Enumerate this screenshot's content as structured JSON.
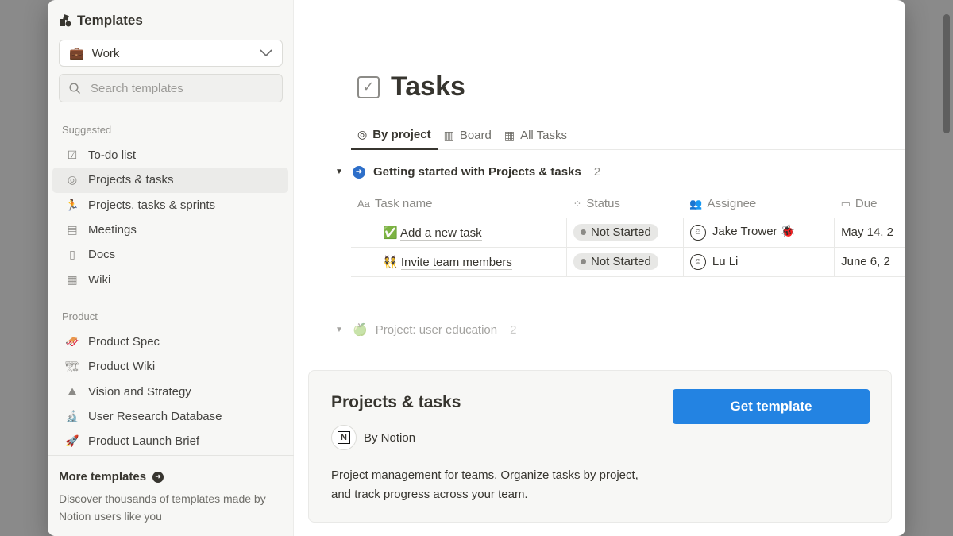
{
  "sidebar": {
    "title": "Templates",
    "category": "Work",
    "search_placeholder": "Search templates",
    "sections": [
      {
        "label": "Suggested",
        "items": [
          {
            "label": "To-do list",
            "icon": "checkbox-icon"
          },
          {
            "label": "Projects & tasks",
            "icon": "target-icon",
            "active": true
          },
          {
            "label": "Projects, tasks & sprints",
            "icon": "runner-icon"
          },
          {
            "label": "Meetings",
            "icon": "notes-icon"
          },
          {
            "label": "Docs",
            "icon": "document-icon"
          },
          {
            "label": "Wiki",
            "icon": "book-icon"
          }
        ]
      },
      {
        "label": "Product",
        "items": [
          {
            "label": "Product Spec",
            "icon": "sled-emoji"
          },
          {
            "label": "Product Wiki",
            "icon": "crane-emoji"
          },
          {
            "label": "Vision and Strategy",
            "icon": "mountain-emoji"
          },
          {
            "label": "User Research Database",
            "icon": "microscope-emoji"
          },
          {
            "label": "Product Launch Brief",
            "icon": "rocket-emoji"
          }
        ]
      }
    ],
    "more": {
      "title": "More templates",
      "description": "Discover thousands of templates made by Notion users like you"
    }
  },
  "preview": {
    "page_title": "Tasks",
    "tabs": [
      {
        "label": "By project",
        "icon": "target-icon",
        "active": true
      },
      {
        "label": "Board",
        "icon": "columns-icon"
      },
      {
        "label": "All Tasks",
        "icon": "table-icon"
      }
    ],
    "group1": {
      "label": "Getting started with Projects & tasks",
      "count": "2"
    },
    "columns": [
      "Task name",
      "Status",
      "Assignee",
      "Due"
    ],
    "column_icons": [
      "Aa",
      "status-icon",
      "people-icon",
      "calendar-icon"
    ],
    "rows": [
      {
        "emoji": "✅",
        "task": "Add a new task",
        "status": "Not Started",
        "assignee": "Jake Trower 🐞",
        "due": "May 14, 2"
      },
      {
        "emoji": "👯",
        "task": "Invite team members",
        "status": "Not Started",
        "assignee": "Lu Li",
        "due": "June 6, 2"
      }
    ],
    "group2": {
      "label": "Project: user education",
      "count": "2"
    }
  },
  "card": {
    "title": "Projects & tasks",
    "author": "By Notion",
    "description": "Project management for teams. Organize tasks by project, and track progress across your team.",
    "button": "Get template"
  },
  "colors": {
    "accent": "#2383e2",
    "sidebar_bg": "#f7f7f5",
    "backdrop": "#8a8a8a"
  }
}
